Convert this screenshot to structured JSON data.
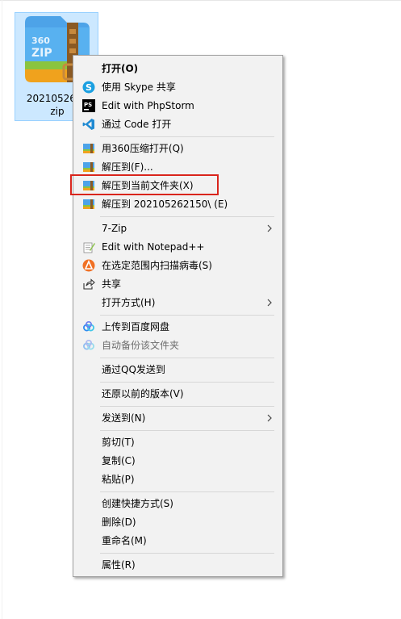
{
  "file": {
    "name_line1": "2021052621",
    "name_line2": "zip",
    "icon_text_top": "360",
    "icon_text_bottom": "ZIP"
  },
  "menu": {
    "items": [
      {
        "label": "打开(O)",
        "icon": "archive-360-icon"
      },
      {
        "label": "使用 Skype 共享",
        "icon": "skype-icon"
      },
      {
        "label": "Edit with PhpStorm",
        "icon": "phpstorm-icon"
      },
      {
        "label": "通过 Code 打开",
        "icon": "vscode-icon"
      },
      {
        "label": "用360压缩打开(Q)",
        "icon": "archive-360-icon"
      },
      {
        "label": "解压到(F)...",
        "icon": "archive-360-icon"
      },
      {
        "label": "解压到当前文件夹(X)",
        "icon": "archive-360-icon"
      },
      {
        "label": "解压到 202105262150\\ (E)",
        "icon": "archive-360-icon"
      },
      {
        "label": "7-Zip",
        "icon": ""
      },
      {
        "label": "Edit with Notepad++",
        "icon": "notepad-plus-plus-icon"
      },
      {
        "label": "在选定范围内扫描病毒(S)",
        "icon": "antivirus-icon"
      },
      {
        "label": "共享",
        "icon": "share-icon"
      },
      {
        "label": "打开方式(H)",
        "icon": ""
      },
      {
        "label": "上传到百度网盘",
        "icon": "baidu-netdisk-icon"
      },
      {
        "label": "自动备份该文件夹",
        "icon": "baidu-netdisk-icon"
      },
      {
        "label": "通过QQ发送到",
        "icon": ""
      },
      {
        "label": "还原以前的版本(V)",
        "icon": ""
      },
      {
        "label": "发送到(N)",
        "icon": ""
      },
      {
        "label": "剪切(T)",
        "icon": ""
      },
      {
        "label": "复制(C)",
        "icon": ""
      },
      {
        "label": "粘贴(P)",
        "icon": ""
      },
      {
        "label": "创建快捷方式(S)",
        "icon": ""
      },
      {
        "label": "删除(D)",
        "icon": ""
      },
      {
        "label": "重命名(M)",
        "icon": ""
      },
      {
        "label": "属性(R)",
        "icon": ""
      }
    ],
    "highlighted_item": "解压到当前文件夹(X)",
    "highlight_color": "#d9251c"
  },
  "colors": {
    "menu_bg": "#f2f2f2",
    "selection_bg": "#cce8ff",
    "disabled_text": "#6d6d6d"
  }
}
